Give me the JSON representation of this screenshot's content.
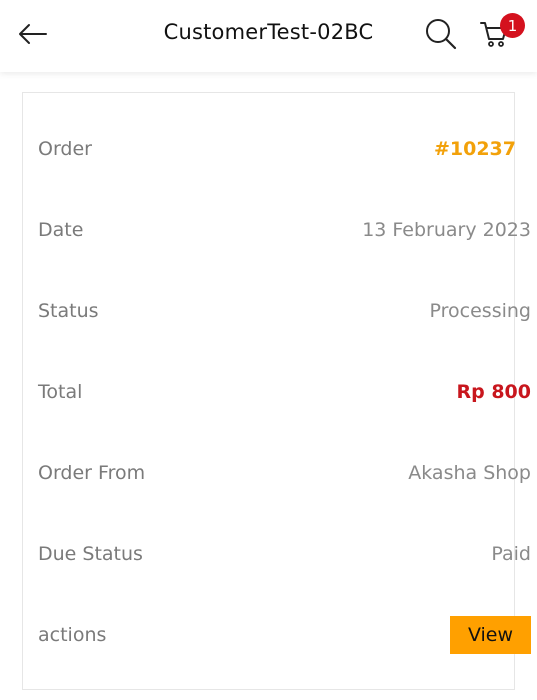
{
  "header": {
    "title": "CustomerTest-02BC",
    "cart_count": "1",
    "icons": [
      "back-arrow-icon",
      "search-icon",
      "cart-icon"
    ]
  },
  "order": {
    "rows": [
      {
        "label": "Order",
        "value": "#10237"
      },
      {
        "label": "Date",
        "value": "13 February 2023"
      },
      {
        "label": "Status",
        "value": "Processing"
      },
      {
        "label": "Total",
        "value": "Rp 800"
      },
      {
        "label": "Order From",
        "value": "Akasha Shop"
      },
      {
        "label": "Due Status",
        "value": "Paid"
      },
      {
        "label": "actions",
        "value": "View"
      }
    ]
  },
  "colors": {
    "accent": "#f2a10a",
    "total": "#c8161d",
    "badge": "#d4111e",
    "button": "#ffa000"
  }
}
